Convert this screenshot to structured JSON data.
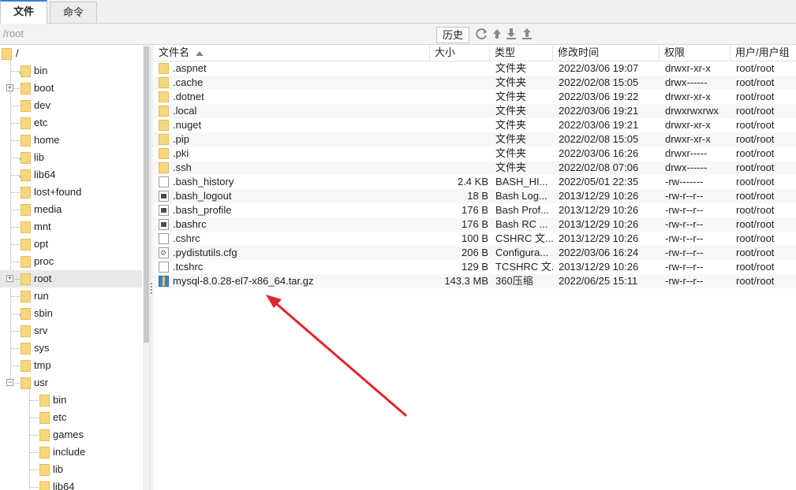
{
  "tabs": [
    {
      "label": "文件",
      "active": true
    },
    {
      "label": "命令",
      "active": false
    }
  ],
  "pathbar": {
    "path": "/root",
    "history_label": "历史",
    "tools": [
      "refresh-icon",
      "up-folder-icon",
      "download-icon",
      "upload-icon"
    ]
  },
  "tree": {
    "root_label": "/",
    "items": [
      {
        "label": "bin",
        "link": true,
        "expandable": false
      },
      {
        "label": "boot",
        "link": false,
        "expandable": true
      },
      {
        "label": "dev",
        "link": false,
        "expandable": false
      },
      {
        "label": "etc",
        "link": false,
        "expandable": false
      },
      {
        "label": "home",
        "link": false,
        "expandable": false
      },
      {
        "label": "lib",
        "link": true,
        "expandable": false
      },
      {
        "label": "lib64",
        "link": true,
        "expandable": false
      },
      {
        "label": "lost+found",
        "link": false,
        "expandable": false
      },
      {
        "label": "media",
        "link": false,
        "expandable": false
      },
      {
        "label": "mnt",
        "link": false,
        "expandable": false
      },
      {
        "label": "opt",
        "link": false,
        "expandable": false
      },
      {
        "label": "proc",
        "link": false,
        "expandable": false
      },
      {
        "label": "root",
        "link": false,
        "expandable": true,
        "selected": true
      },
      {
        "label": "run",
        "link": false,
        "expandable": false
      },
      {
        "label": "sbin",
        "link": true,
        "expandable": false
      },
      {
        "label": "srv",
        "link": false,
        "expandable": false
      },
      {
        "label": "sys",
        "link": false,
        "expandable": false
      },
      {
        "label": "tmp",
        "link": false,
        "expandable": false
      },
      {
        "label": "usr",
        "link": false,
        "expandable": true,
        "expanded": true
      }
    ],
    "usr_children": [
      "bin",
      "etc",
      "games",
      "include",
      "lib",
      "lib64"
    ]
  },
  "list": {
    "columns": {
      "name": "文件名",
      "size": "大小",
      "type": "类型",
      "modified": "修改时间",
      "perms": "权限",
      "owner": "用户/用户组"
    },
    "files": [
      {
        "name": ".aspnet",
        "size": "",
        "type": "文件夹",
        "modified": "2022/03/06 19:07",
        "perms": "drwxr-xr-x",
        "owner": "root/root",
        "icon": "folder"
      },
      {
        "name": ".cache",
        "size": "",
        "type": "文件夹",
        "modified": "2022/02/08 15:05",
        "perms": "drwx------",
        "owner": "root/root",
        "icon": "folder"
      },
      {
        "name": ".dotnet",
        "size": "",
        "type": "文件夹",
        "modified": "2022/03/06 19:22",
        "perms": "drwxr-xr-x",
        "owner": "root/root",
        "icon": "folder"
      },
      {
        "name": ".local",
        "size": "",
        "type": "文件夹",
        "modified": "2022/03/06 19:21",
        "perms": "drwxrwxrwx",
        "owner": "root/root",
        "icon": "folder"
      },
      {
        "name": ".nuget",
        "size": "",
        "type": "文件夹",
        "modified": "2022/03/06 19:21",
        "perms": "drwxr-xr-x",
        "owner": "root/root",
        "icon": "folder"
      },
      {
        "name": ".pip",
        "size": "",
        "type": "文件夹",
        "modified": "2022/02/08 15:05",
        "perms": "drwxr-xr-x",
        "owner": "root/root",
        "icon": "folder"
      },
      {
        "name": ".pki",
        "size": "",
        "type": "文件夹",
        "modified": "2022/03/06 16:26",
        "perms": "drwxr-----",
        "owner": "root/root",
        "icon": "folder"
      },
      {
        "name": ".ssh",
        "size": "",
        "type": "文件夹",
        "modified": "2022/02/08 07:06",
        "perms": "drwx------",
        "owner": "root/root",
        "icon": "folder"
      },
      {
        "name": ".bash_history",
        "size": "2.4 KB",
        "type": "BASH_HI...",
        "modified": "2022/05/01 22:35",
        "perms": "-rw-------",
        "owner": "root/root",
        "icon": "doc"
      },
      {
        "name": ".bash_logout",
        "size": "18 B",
        "type": "Bash Log...",
        "modified": "2013/12/29 10:26",
        "perms": "-rw-r--r--",
        "owner": "root/root",
        "icon": "script"
      },
      {
        "name": ".bash_profile",
        "size": "176 B",
        "type": "Bash Prof...",
        "modified": "2013/12/29 10:26",
        "perms": "-rw-r--r--",
        "owner": "root/root",
        "icon": "script"
      },
      {
        "name": ".bashrc",
        "size": "176 B",
        "type": "Bash RC ...",
        "modified": "2013/12/29 10:26",
        "perms": "-rw-r--r--",
        "owner": "root/root",
        "icon": "script"
      },
      {
        "name": ".cshrc",
        "size": "100 B",
        "type": "CSHRC 文...",
        "modified": "2013/12/29 10:26",
        "perms": "-rw-r--r--",
        "owner": "root/root",
        "icon": "doc"
      },
      {
        "name": ".pydistutils.cfg",
        "size": "206 B",
        "type": "Configura...",
        "modified": "2022/03/06 16:24",
        "perms": "-rw-r--r--",
        "owner": "root/root",
        "icon": "cfg"
      },
      {
        "name": ".tcshrc",
        "size": "129 B",
        "type": "TCSHRC 文...",
        "modified": "2013/12/29 10:26",
        "perms": "-rw-r--r--",
        "owner": "root/root",
        "icon": "doc"
      },
      {
        "name": "mysql-8.0.28-el7-x86_64.tar.gz",
        "size": "143.3 MB",
        "type": "360压缩",
        "modified": "2022/06/25 15:11",
        "perms": "-rw-r--r--",
        "owner": "root/root",
        "icon": "archive"
      }
    ]
  },
  "annotation": {
    "arrow_color": "#e0262b"
  }
}
